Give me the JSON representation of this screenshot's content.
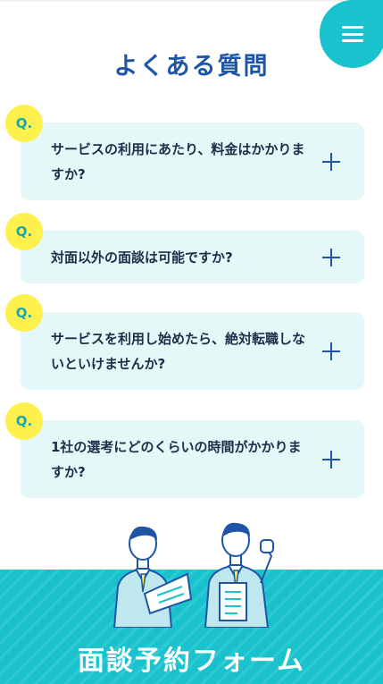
{
  "menu": {
    "icon": "hamburger-icon"
  },
  "section": {
    "title": "よくある質問"
  },
  "faq": {
    "badge": "Q.",
    "items": [
      {
        "question": "サービスの利用にあたり、料金はかかりますか?"
      },
      {
        "question": "対面以外の面談は可能ですか?"
      },
      {
        "question": "サービスを利用し始めたら、絶対転職しないといけませんか?"
      },
      {
        "question": "1社の選考にどのくらいの時間がかかりますか?"
      }
    ]
  },
  "cta": {
    "title": "面談予約フォーム"
  },
  "colors": {
    "accent": "#19c2cc",
    "highlight": "#fff14d",
    "title": "#1f55a6",
    "card": "#e6f7f8"
  }
}
